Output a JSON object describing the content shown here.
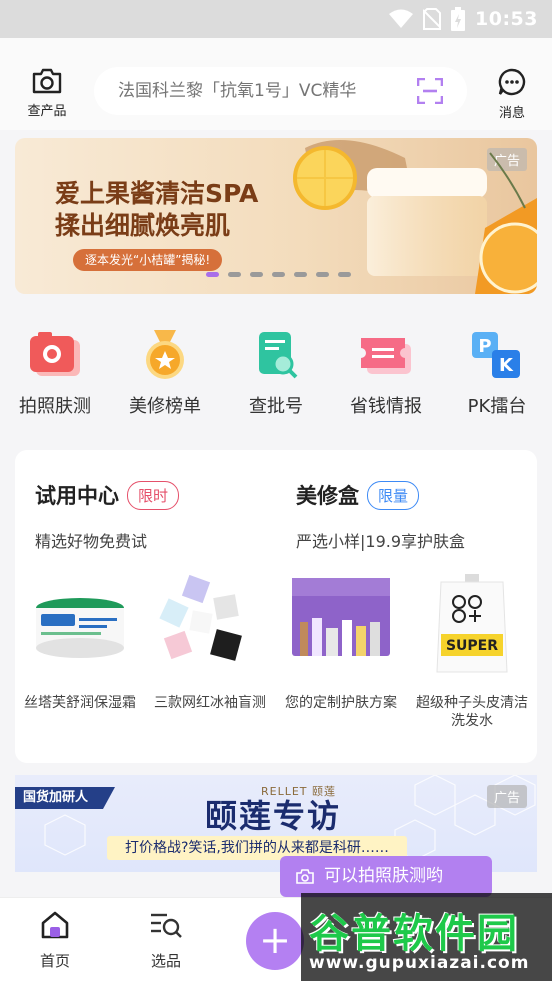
{
  "status_bar": {
    "time": "10:53"
  },
  "header": {
    "scan_label": "查产品",
    "search_placeholder": "法国科兰黎「抗氧1号」VC精华",
    "message_label": "消息"
  },
  "banner": {
    "title_line1": "爱上果酱清洁SPA",
    "title_line2": "揉出细腻焕亮肌",
    "subtitle": "逐本发光“小桔罐”揭秘!",
    "ad_label": "广告",
    "dot_count": 7,
    "active_dot": 0
  },
  "quick_nav": [
    {
      "label": "拍照肤测",
      "icon": "camera-icon"
    },
    {
      "label": "美修榜单",
      "icon": "medal-icon"
    },
    {
      "label": "查批号",
      "icon": "document-search-icon"
    },
    {
      "label": "省钱情报",
      "icon": "coupon-icon"
    },
    {
      "label": "PK擂台",
      "icon": "pk-icon"
    }
  ],
  "trial_center": {
    "title": "试用中心",
    "tag": "限时",
    "subtitle": "精选好物免费试",
    "products": [
      {
        "name": "丝塔芙舒润保湿霜"
      },
      {
        "name": "三款网红冰袖盲测"
      }
    ]
  },
  "beauty_box": {
    "title": "美修盒",
    "tag": "限量",
    "subtitle": "严选小样|19.9享护肤盒",
    "products": [
      {
        "name": "您的定制护肤方案"
      },
      {
        "name": "超级种子头皮清洁洗发水"
      }
    ]
  },
  "ad_banner_2": {
    "tag": "国货加研人",
    "brand": "RELLET 颐莲",
    "title": "颐莲专访",
    "slogan": "打价格战?笑话,我们拼的从来都是科研……",
    "ad_label": "广告"
  },
  "tooltip": {
    "text": "可以拍照肤测哟"
  },
  "bottom_nav": {
    "home_label": "首页",
    "select_label": "选品",
    "fab_symbol": "+"
  },
  "watermark": {
    "text_cn": "谷普软件园",
    "url": "www.gupuxiazai.com"
  },
  "colors": {
    "accent": "#b280f0",
    "tag_red": "#e5506a",
    "tag_blue": "#3d8af5"
  }
}
